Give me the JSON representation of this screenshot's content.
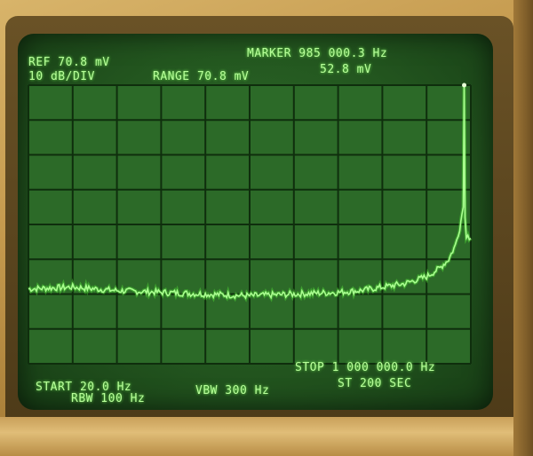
{
  "display": {
    "ref_level": "REF 70.8 mV",
    "scale": "10 dB/DIV",
    "range": "RANGE 70.8 mV",
    "marker_freq": "MARKER 985 000.3 Hz",
    "marker_amp": "52.8 mV",
    "start": "START 20.0 Hz",
    "rbw": "RBW 100 Hz",
    "vbw": "VBW 300 Hz",
    "stop": "STOP 1 000 000.0 Hz",
    "sweep_time": "ST 200 SEC"
  },
  "chart_data": {
    "type": "line",
    "xlabel": "",
    "ylabel": "",
    "xlim": [
      20.0,
      1000000.0
    ],
    "ylim_div": [
      0,
      8
    ],
    "grid": true,
    "series": [
      {
        "x": [
          20,
          100000,
          200000,
          300000,
          400000,
          500000,
          600000,
          700000,
          750000,
          800000,
          850000,
          900000,
          930000,
          950000,
          965000,
          975000,
          980000,
          983000,
          985000,
          987000,
          990000,
          1000000
        ],
        "y_div_from_bottom": [
          2.15,
          2.2,
          2.1,
          2.05,
          2.0,
          1.95,
          2.0,
          2.05,
          2.1,
          2.2,
          2.3,
          2.5,
          2.75,
          3.0,
          3.4,
          3.9,
          4.3,
          4.5,
          8.0,
          4.2,
          3.7,
          3.6
        ]
      }
    ],
    "marker": {
      "x": 985000.3,
      "y": "52.8 mV"
    }
  },
  "colors": {
    "trace": "#aaff90",
    "grid": "#0f2e0d",
    "text": "#b8ff9a"
  }
}
